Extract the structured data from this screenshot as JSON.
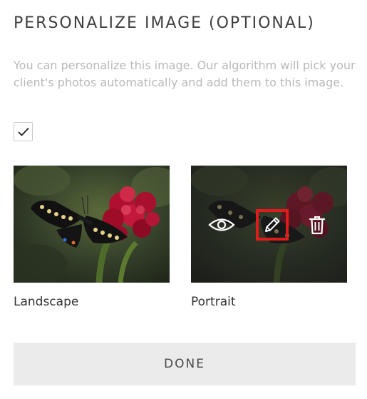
{
  "section": {
    "title": "PERSONALIZE IMAGE (OPTIONAL)",
    "description": "You can personalize this image. Our algorithm will pick your client's photos automatically and add them to this image.",
    "checkbox_checked": true
  },
  "images": [
    {
      "label": "Landscape",
      "hovered": false
    },
    {
      "label": "Portrait",
      "hovered": true
    }
  ],
  "actions": [
    {
      "icon": "eye-icon"
    },
    {
      "icon": "pencil-icon",
      "highlighted": true,
      "highlight_color": "#e01b1b"
    },
    {
      "icon": "trash-icon"
    }
  ],
  "footer": {
    "done_label": "DONE"
  },
  "colors": {
    "title": "#3f3f3f",
    "description": "#b8b8b8",
    "button_bg": "#ebebeb"
  }
}
